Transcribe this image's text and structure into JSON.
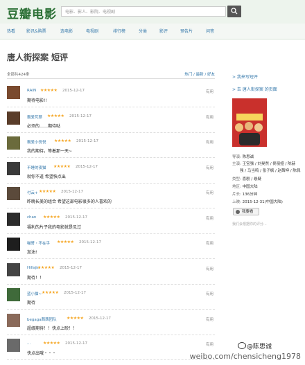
{
  "header": {
    "logo": "豆瓣电影",
    "search_placeholder": "电影、影人、影院、电视剧"
  },
  "nav": [
    "热看",
    "影讯&购票",
    "选电影",
    "电视剧",
    "排行榜",
    "分类",
    "影评",
    "预告片",
    "问答"
  ],
  "page": {
    "title": "唐人街探案 短评",
    "count": "全部共424条",
    "sort": "热门 / 最新 / 好友"
  },
  "reviews": [
    {
      "user": "RAIN",
      "stars": "★★★★★",
      "date": "2015-12-17",
      "useful": "有用",
      "text": "期待电影!!",
      "avatar": "#7a4a2e"
    },
    {
      "user": "霸爱芃萘",
      "stars": "★★★★★",
      "date": "2015-12-17",
      "useful": "有用",
      "text": "必须的……期待哒",
      "avatar": "#5a3d2a"
    },
    {
      "user": "霸爱小悦悦",
      "stars": "★★★★★",
      "date": "2015-12-17",
      "useful": "有用",
      "text": "我的期待，等着那一天~",
      "avatar": "#6b6b3c"
    },
    {
      "user": "不睡的夜猫",
      "stars": "★★★★★",
      "date": "2015-12-17",
      "useful": "有用",
      "text": "就你不道 希望快点出",
      "avatar": "#3a3a3a"
    },
    {
      "user": "付云+",
      "stars": "★★★★★",
      "date": "2015-12-17",
      "useful": "有用",
      "text": "昨晚长美的组合 希望这部电影很多的人喜欢的",
      "avatar": "#5b4a3b"
    },
    {
      "user": "chan",
      "stars": "★★★★★",
      "date": "2015-12-17",
      "useful": "有用",
      "text": "福利的片子我的电影就是见过",
      "avatar": "#2c2c2c"
    },
    {
      "user": "喵哥・不在乎",
      "stars": "★★★★★",
      "date": "2015-12-17",
      "useful": "有用",
      "text": "加油!",
      "avatar": "#1e1e1e"
    },
    {
      "user": "Hillsjin",
      "stars": "★★★★★",
      "date": "2015-12-17",
      "useful": "有用",
      "text": "期待！！",
      "avatar": "#444444"
    },
    {
      "user": "蓝小猫~",
      "stars": "★★★★★",
      "date": "2015-12-17",
      "useful": "有用",
      "text": "期待",
      "avatar": "#3f6a3a"
    },
    {
      "user": "begaga茜茜团队",
      "stars": "★★★★★",
      "date": "2015-12-17",
      "useful": "有用",
      "text": "超级期待！！快点上映！！",
      "avatar": "#8a6a5a"
    },
    {
      "user": "...",
      "stars": "★★★★★",
      "date": "2015-12-17",
      "useful": "有用",
      "text": "快点出哦・・・",
      "avatar": "#6a6a6a"
    }
  ],
  "sidebar": {
    "write_link": "> 我来写短评",
    "back_link": "> 去 唐人街探案 的页面",
    "director_label": "导演:",
    "director": "陈思诚",
    "cast_label": "主演:",
    "cast": "王宝强 / 刘昊然 / 佟丽娅 / 陈赫",
    "cast2": "强 / 马当鸣 / 张子枫 / 赵茜坤 / 陈佩",
    "genre_label": "类型:",
    "genre": "喜剧 / 悬疑",
    "region_label": "地区:",
    "region": "中国大陆",
    "runtime_label": "片长:",
    "runtime": "136分钟",
    "release_label": "上映:",
    "release": "2015-12-31(中国大陆)",
    "play_button": "我要看",
    "note": "我们会根据你的评分..."
  },
  "watermark": {
    "url": "weibo.com/chensicheng1978",
    "handle": "@陈思诚"
  }
}
